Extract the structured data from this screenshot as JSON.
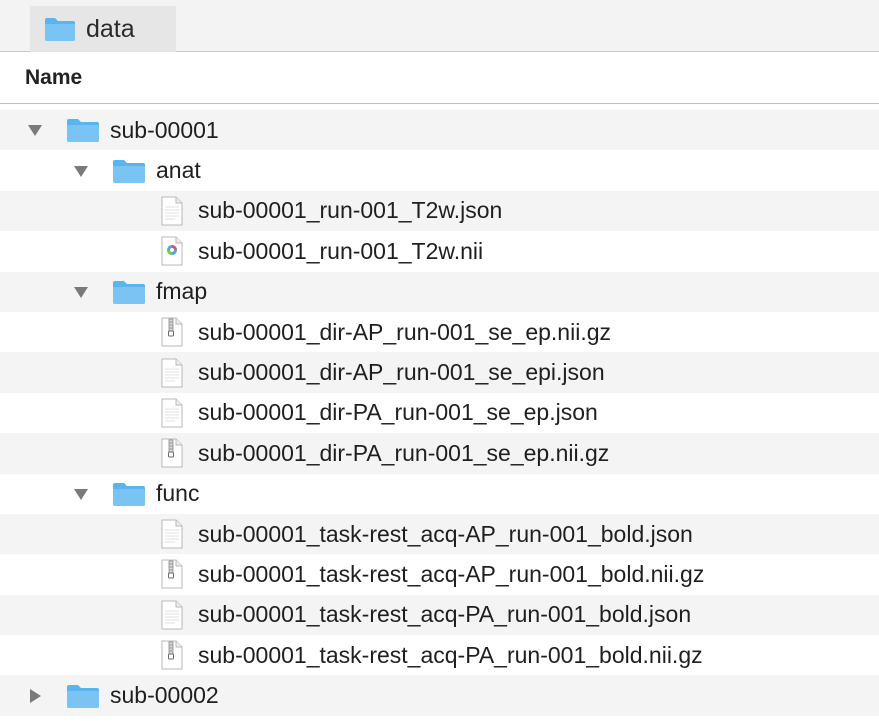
{
  "window": {
    "tab_title": "data",
    "tab_icon": "folder-icon"
  },
  "columns": {
    "name_header": "Name"
  },
  "colors": {
    "folder_blue": "#5ab4ee",
    "folder_tab_blue": "#79c4f2",
    "alt_row": "#f4f4f4",
    "triangle": "#7a7a7a"
  },
  "tree": [
    {
      "label": "sub-00001",
      "kind": "folder",
      "level": 0,
      "expanded": true
    },
    {
      "label": "anat",
      "kind": "folder",
      "level": 1,
      "expanded": true
    },
    {
      "label": "sub-00001_run-001_T2w.json",
      "kind": "json",
      "level": 2
    },
    {
      "label": "sub-00001_run-001_T2w.nii",
      "kind": "nifti",
      "level": 2
    },
    {
      "label": "fmap",
      "kind": "folder",
      "level": 1,
      "expanded": true
    },
    {
      "label": "sub-00001_dir-AP_run-001_se_ep.nii.gz",
      "kind": "archive",
      "level": 2
    },
    {
      "label": "sub-00001_dir-AP_run-001_se_epi.json",
      "kind": "json",
      "level": 2
    },
    {
      "label": "sub-00001_dir-PA_run-001_se_ep.json",
      "kind": "json",
      "level": 2
    },
    {
      "label": "sub-00001_dir-PA_run-001_se_ep.nii.gz",
      "kind": "archive",
      "level": 2
    },
    {
      "label": "func",
      "kind": "folder",
      "level": 1,
      "expanded": true
    },
    {
      "label": "sub-00001_task-rest_acq-AP_run-001_bold.json",
      "kind": "json",
      "level": 2
    },
    {
      "label": "sub-00001_task-rest_acq-AP_run-001_bold.nii.gz",
      "kind": "archive",
      "level": 2
    },
    {
      "label": "sub-00001_task-rest_acq-PA_run-001_bold.json",
      "kind": "json",
      "level": 2
    },
    {
      "label": "sub-00001_task-rest_acq-PA_run-001_bold.nii.gz",
      "kind": "archive",
      "level": 2
    },
    {
      "label": "sub-00002",
      "kind": "folder",
      "level": 0,
      "expanded": false
    }
  ],
  "nifti_badge": "NIfTI"
}
